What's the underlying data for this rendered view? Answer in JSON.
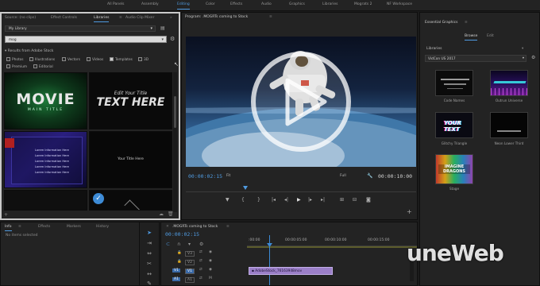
{
  "workspaces": {
    "items": [
      "All Panels",
      "Assembly",
      "Editing",
      "Color",
      "Effects",
      "Audio",
      "Graphics",
      "Libraries",
      "Mograts 2",
      "NF Workspace"
    ],
    "active": "Editing"
  },
  "left_panel": {
    "tabs": [
      "Source: (no clips)",
      "Effect Controls",
      "Libraries",
      "Audio Clip Mixer"
    ],
    "active_tab": "Libraries",
    "library_select": "My Library",
    "search_value": "mog",
    "results_header": "Results from Adobe Stock",
    "filters": [
      {
        "label": "Photos",
        "checked": false
      },
      {
        "label": "Illustrations",
        "checked": false
      },
      {
        "label": "Vectors",
        "checked": false
      },
      {
        "label": "Videos",
        "checked": false
      },
      {
        "label": "Templates",
        "checked": true
      },
      {
        "label": "3D",
        "checked": false
      },
      {
        "label": "Premium",
        "checked": false
      },
      {
        "label": "Editorial",
        "checked": false
      }
    ],
    "thumbs": {
      "movie_title": "MOVIE",
      "movie_sub": "MAIN TITLE",
      "edit_small": "Edit Your Title",
      "edit_big": "TEXT HERE",
      "list_items": [
        "Lorem Information Here",
        "Lorem Information Here",
        "Lorem Information Here",
        "Lorem Information Here",
        "Lorem Information Here"
      ],
      "your_title": "Your Title Here"
    }
  },
  "bottom_left": {
    "tabs": [
      "Info",
      "Effects",
      "Markers",
      "History"
    ],
    "active_tab": "Info",
    "status": "No items selected"
  },
  "program": {
    "title": "Program: .MOGRTs coming to Stock",
    "timecode_current": "00:00:02:15",
    "fit": "Fit",
    "quality": "Full",
    "timecode_duration": "00:00:10:00"
  },
  "essential_graphics": {
    "title": "Essential Graphics",
    "tabs": [
      "Browse",
      "Edit"
    ],
    "active_tab": "Browse",
    "section": "Libraries",
    "library": "VidCon US 2017",
    "templates": [
      {
        "label": "Code Names"
      },
      {
        "label": "Outrun Universe"
      },
      {
        "label": "Glitchy Triangle",
        "thumb_text": "YOUR TEXT"
      },
      {
        "label": "Neon Lower Third"
      },
      {
        "label": "Stage",
        "thumb_text": "IMAGINE DRAGONS"
      }
    ]
  },
  "timeline": {
    "title": ".MOGRTs coming to Stock",
    "timecode": "00:00:02:15",
    "ruler": [
      ":00:00",
      "00:00:05:00",
      "00:00:10:00",
      "00:00:15:00"
    ],
    "tracks": [
      "V3",
      "V2",
      "V1",
      "A1"
    ],
    "clip_label": "AdobeStock_76163948mov"
  },
  "watermark": {
    "text": "uneWeb"
  },
  "colors": {
    "accent": "#4f9ae0",
    "clip": "#9b7fc8",
    "playhead": "#3d8bd6"
  }
}
